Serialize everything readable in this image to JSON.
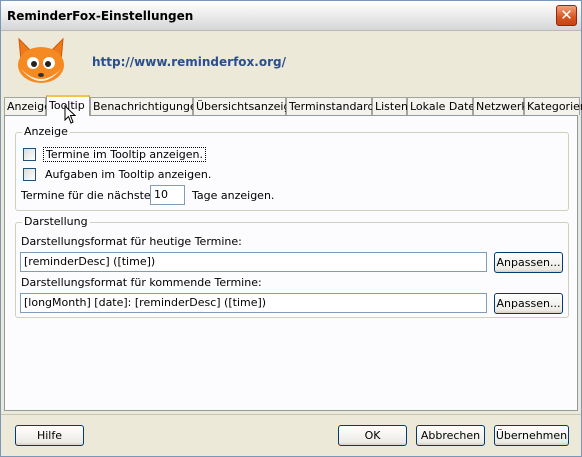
{
  "window": {
    "title": "ReminderFox-Einstellungen",
    "close_label": "✕"
  },
  "header": {
    "url": "http://www.reminderfox.org/"
  },
  "tabs": [
    "Anzeige",
    "Tooltip",
    "Benachrichtigungen",
    "Übersichtsanzeige",
    "Terminstandards",
    "Listen",
    "Lokale Datei",
    "Netzwerk",
    "Kategorien"
  ],
  "active_tab": "Tooltip",
  "anzeige": {
    "title": "Anzeige",
    "show_events_label": "Termine im Tooltip anzeigen.",
    "show_events_checked": false,
    "show_tasks_label": "Aufgaben im Tooltip anzeigen.",
    "show_tasks_checked": false,
    "days_prefix": "Termine für die nächsten",
    "days_value": "10",
    "days_suffix": "Tage anzeigen."
  },
  "darstellung": {
    "title": "Darstellung",
    "today_label": "Darstellungsformat für heutige Termine:",
    "today_value": "[reminderDesc] ([time])",
    "upcoming_label": "Darstellungsformat für kommende Termine:",
    "upcoming_value": "[longMonth] [date]: [reminderDesc] ([time])",
    "customize_label": "Anpassen..."
  },
  "footer": {
    "help_label": "Hilfe",
    "ok_label": "OK",
    "cancel_label": "Abbrechen",
    "apply_label": "Übernehmen"
  },
  "colors": {
    "link": "#2b4f8a",
    "active_tab_accent": "#f0c44a",
    "close_button": "#d8541e"
  }
}
